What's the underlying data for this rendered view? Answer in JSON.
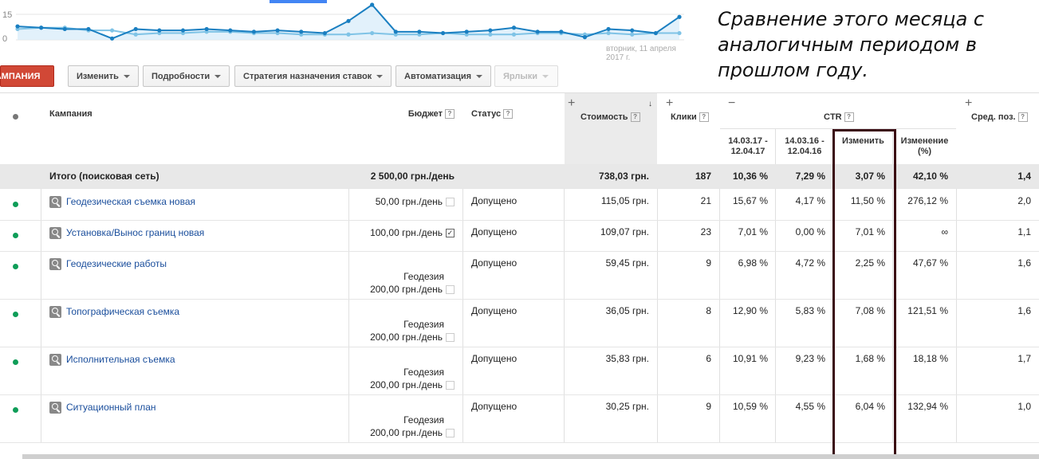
{
  "sparkline": {
    "y_labels": [
      "15",
      "0"
    ],
    "date_label": "вторник, 11 апреля 2017 г.",
    "current_series_color": "#1a7fc1",
    "previous_series_color": "#7fc3e6",
    "current": [
      10,
      9,
      8,
      8,
      1,
      8,
      7,
      7,
      8,
      7,
      6,
      7,
      6,
      5,
      14,
      26,
      6,
      6,
      5,
      6,
      7,
      9,
      6,
      6,
      2,
      8,
      7,
      5,
      17
    ],
    "previous": [
      8,
      9,
      9,
      7,
      7,
      4,
      5,
      5,
      6,
      6,
      5,
      5,
      4,
      4,
      4,
      5,
      4,
      4,
      5,
      4,
      4,
      4,
      5,
      5,
      4,
      5,
      4,
      5,
      5
    ]
  },
  "annotation": "Сравнение этого месяца с аналогичным периодом в прошлом году.",
  "toolbar": {
    "campaign_btn": "КАМПАНИЯ",
    "edit": "Изменить",
    "details": "Подробности",
    "bid_strategy": "Стратегия назначения ставок",
    "automation": "Автоматизация",
    "labels": "Ярлыки"
  },
  "header": {
    "campaign": "Кампания",
    "budget": "Бюджет",
    "status": "Статус",
    "cost": "Стоимость",
    "clicks": "Клики",
    "ctr": "CTR",
    "period1": "14.03.17 - 12.04.17",
    "period2": "14.03.16 - 12.04.16",
    "change": "Изменить",
    "change_pct": "Изменение (%)",
    "avg_pos": "Сред. поз."
  },
  "total": {
    "label": "Итого (поисковая сеть)",
    "budget": "2 500,00 грн./день",
    "cost": "738,03 грн.",
    "clicks": "187",
    "ctr1": "10,36 %",
    "ctr2": "7,29 %",
    "change": "3,07 %",
    "change_pct": "42,10 %",
    "avg_pos": "1,4"
  },
  "rows": [
    {
      "name": "Геодезическая съемка новая",
      "budget_group": "",
      "budget": "50,00 грн./день",
      "status": "Допущено",
      "cost": "115,05 грн.",
      "clicks": "21",
      "ctr1": "15,67 %",
      "ctr2": "4,17 %",
      "change": "11,50 %",
      "change_pct": "276,12 %",
      "avg_pos": "2,0"
    },
    {
      "name": "Установка/Вынос границ новая",
      "budget_group": "",
      "budget": "100,00 грн./день",
      "status": "Допущено",
      "cost": "109,07 грн.",
      "clicks": "23",
      "ctr1": "7,01 %",
      "ctr2": "0,00 %",
      "change": "7,01 %",
      "change_pct": "∞",
      "avg_pos": "1,1"
    },
    {
      "name": "Геодезические работы",
      "budget_group": "Геодезия",
      "budget": "200,00 грн./день",
      "status": "Допущено",
      "cost": "59,45 грн.",
      "clicks": "9",
      "ctr1": "6,98 %",
      "ctr2": "4,72 %",
      "change": "2,25 %",
      "change_pct": "47,67 %",
      "avg_pos": "1,6"
    },
    {
      "name": "Топографическая съемка",
      "budget_group": "Геодезия",
      "budget": "200,00 грн./день",
      "status": "Допущено",
      "cost": "36,05 грн.",
      "clicks": "8",
      "ctr1": "12,90 %",
      "ctr2": "5,83 %",
      "change": "7,08 %",
      "change_pct": "121,51 %",
      "avg_pos": "1,6"
    },
    {
      "name": "Исполнительная съемка",
      "budget_group": "Геодезия",
      "budget": "200,00 грн./день",
      "status": "Допущено",
      "cost": "35,83 грн.",
      "clicks": "6",
      "ctr1": "10,91 %",
      "ctr2": "9,23 %",
      "change": "1,68 %",
      "change_pct": "18,18 %",
      "avg_pos": "1,7"
    },
    {
      "name": "Ситуационный план",
      "budget_group": "Геодезия",
      "budget": "200,00 грн./день",
      "status": "Допущено",
      "cost": "30,25 грн.",
      "clicks": "9",
      "ctr1": "10,59 %",
      "ctr2": "4,55 %",
      "change": "6,04 %",
      "change_pct": "132,94 %",
      "avg_pos": "1,0"
    }
  ]
}
